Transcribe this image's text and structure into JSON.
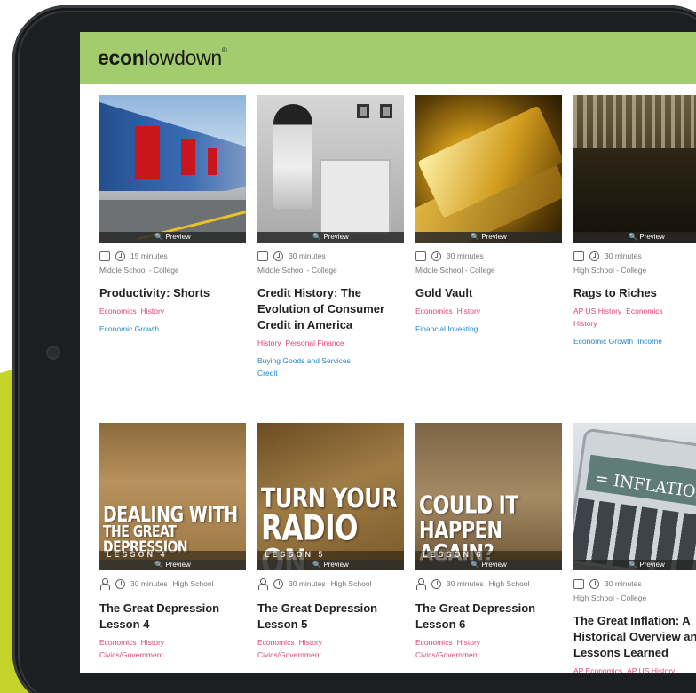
{
  "logo": {
    "bold": "econ",
    "rest": "lowdown",
    "tm": "®"
  },
  "preview_label": "🔍 Preview",
  "cards": [
    {
      "thumb": "loading-dock",
      "duration": "15 minutes",
      "grade": "Middle School - College",
      "title": "Productivity: Shorts",
      "subjects": [
        "Economics",
        "History"
      ],
      "topics": [
        "Economic Growth"
      ]
    },
    {
      "thumb": "credit-history",
      "duration": "30 minutes",
      "grade": "Middle School - College",
      "title": "Credit History: The Evolution of Consumer Credit in America",
      "subjects": [
        "History",
        "Personal Finance"
      ],
      "topics": [
        "Buying Goods and Services",
        "Credit"
      ]
    },
    {
      "thumb": "gold-vault",
      "duration": "30 minutes",
      "grade": "Middle School - College",
      "title": "Gold Vault",
      "subjects": [
        "Economics",
        "History"
      ],
      "topics": [
        "Financial Investing"
      ]
    },
    {
      "thumb": "rags-to-riches",
      "duration": "30 minutes",
      "grade": "High School - College",
      "title": "Rags to Riches",
      "subjects": [
        "AP US History",
        "Economics",
        "History"
      ],
      "topics": [
        "Economic Growth",
        "Income"
      ]
    },
    {
      "thumb": "great-depression-4",
      "duration": "30 minutes",
      "grade": "High School",
      "title": "The Great Depression Lesson 4",
      "image_text": [
        "DEALING WITH",
        "THE GREAT DEPRESSION",
        "LESSON 4"
      ],
      "subjects": [
        "Economics",
        "History",
        "Civics/Government"
      ],
      "topics": []
    },
    {
      "thumb": "great-depression-5",
      "duration": "30 minutes",
      "grade": "High School",
      "title": "The Great Depression Lesson 5",
      "image_text": [
        "TURN YOUR",
        "RADIO ON",
        "LESSON 5"
      ],
      "subjects": [
        "Economics",
        "History",
        "Civics/Government"
      ],
      "topics": []
    },
    {
      "thumb": "great-depression-6",
      "duration": "30 minutes",
      "grade": "High School",
      "title": "The Great Depression Lesson 6",
      "image_text": [
        "COULD IT",
        "HAPPEN AGAIN?",
        "LESSON 6"
      ],
      "subjects": [
        "Economics",
        "History",
        "Civics/Government"
      ],
      "topics": []
    },
    {
      "thumb": "great-inflation",
      "duration": "30 minutes",
      "grade": "High School - College",
      "title": "The Great Inflation: A Historical Overview and Lessons Learned",
      "image_text": [
        "= INFLATION"
      ],
      "subjects": [
        "AP Economics",
        "AP US History"
      ],
      "topics": []
    }
  ]
}
